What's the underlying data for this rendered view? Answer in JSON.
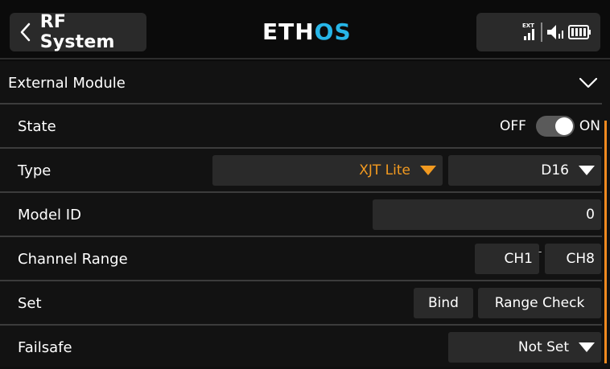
{
  "header": {
    "title": "RF System",
    "brand_main": "ETH",
    "brand_accent": "OS",
    "status_icons": [
      "external-signal-icon",
      "speaker-icon",
      "battery-icon"
    ],
    "status_ext_label": "EXT"
  },
  "section": {
    "label": "External Module",
    "expanded": true
  },
  "rows": {
    "state": {
      "label": "State",
      "off": "OFF",
      "on": "ON",
      "value": "ON"
    },
    "type": {
      "label": "Type",
      "protocol": "XJT Lite",
      "mode": "D16"
    },
    "model_id": {
      "label": "Model ID",
      "value": "0"
    },
    "channel_range": {
      "label": "Channel Range",
      "start": "CH1",
      "separator": "-",
      "end": "CH8"
    },
    "set": {
      "label": "Set",
      "bind": "Bind",
      "range_check": "Range Check"
    },
    "failsafe": {
      "label": "Failsafe",
      "value": "Not Set"
    }
  },
  "colors": {
    "accent_orange": "#f29a20",
    "brand_blue": "#27b6e8",
    "scrollbar": "#f28a20",
    "field_bg": "#2a2a2a"
  }
}
